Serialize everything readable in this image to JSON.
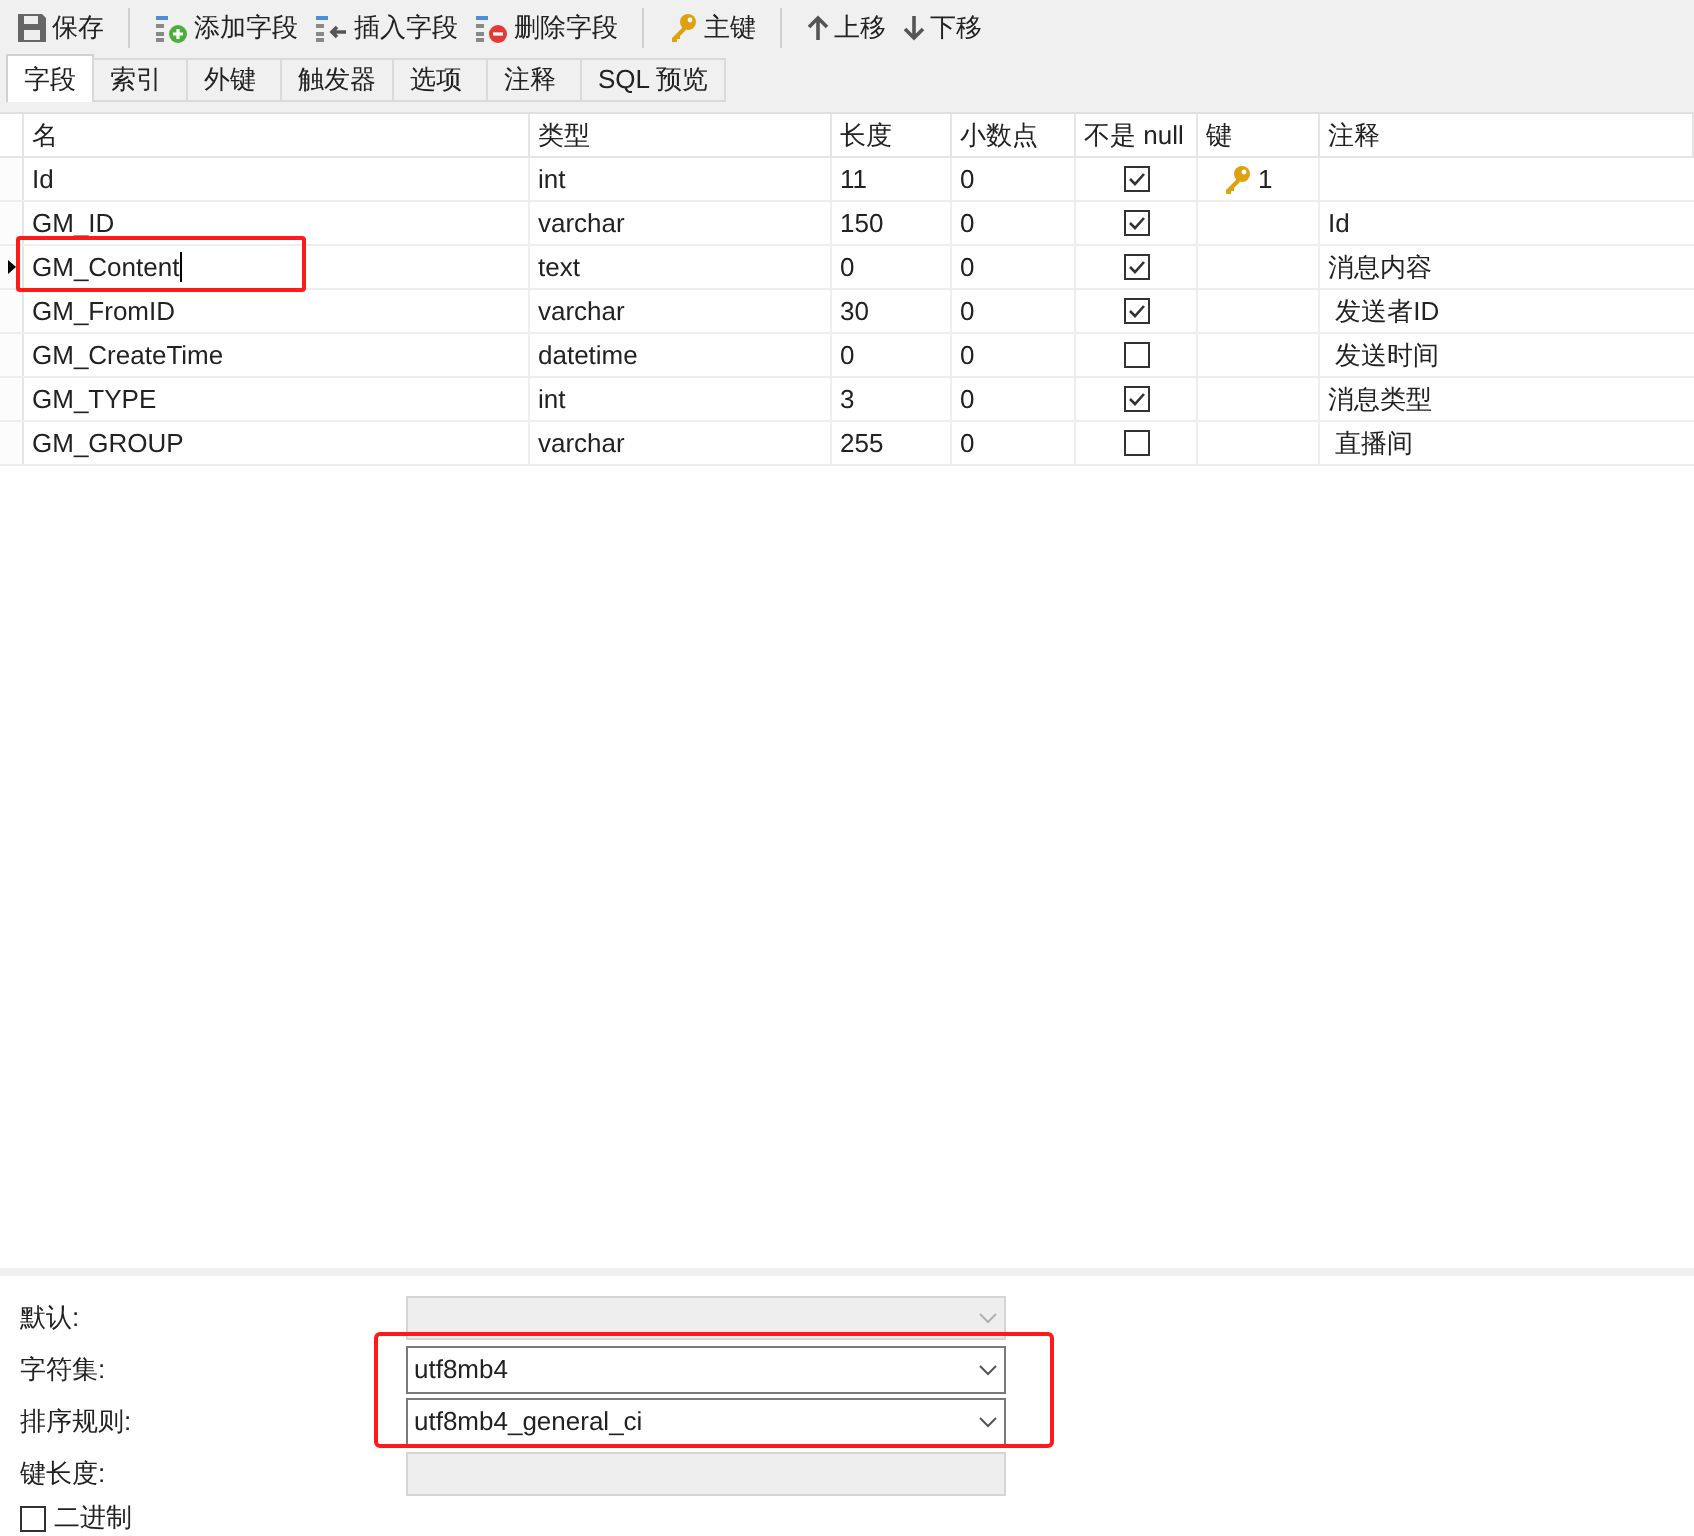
{
  "toolbar": [
    {
      "kind": "save",
      "label": "保存"
    },
    {
      "kind": "add",
      "label": "添加字段"
    },
    {
      "kind": "insert",
      "label": "插入字段"
    },
    {
      "kind": "delete",
      "label": "删除字段"
    },
    {
      "kind": "key",
      "label": "主键"
    },
    {
      "kind": "up",
      "label": "上移"
    },
    {
      "kind": "down",
      "label": "下移"
    }
  ],
  "tabs": [
    {
      "label": "字段",
      "selected": true
    },
    {
      "label": "索引",
      "selected": false
    },
    {
      "label": "外键",
      "selected": false
    },
    {
      "label": "触发器",
      "selected": false
    },
    {
      "label": "选项",
      "selected": false
    },
    {
      "label": "注释",
      "selected": false
    },
    {
      "label": "SQL 预览",
      "selected": false
    }
  ],
  "table": {
    "columns": [
      "名",
      "类型",
      "长度",
      "小数点",
      "不是 null",
      "键",
      "注释"
    ],
    "rows": [
      {
        "name": "Id",
        "type": "int",
        "length": "11",
        "decimals": "0",
        "not_null": true,
        "key": "1",
        "selected": false
      },
      {
        "name": "GM_ID",
        "type": "varchar",
        "length": "150",
        "decimals": "0",
        "not_null": true,
        "comment": "Id",
        "selected": false
      },
      {
        "name": "GM_Content",
        "type": "text",
        "length": "0",
        "decimals": "0",
        "not_null": true,
        "comment": "消息内容",
        "selected": true
      },
      {
        "name": "GM_FromID",
        "type": "varchar",
        "length": "30",
        "decimals": "0",
        "not_null": true,
        "comment": " 发送者ID",
        "selected": false
      },
      {
        "name": "GM_CreateTime",
        "type": "datetime",
        "length": "0",
        "decimals": "0",
        "not_null": false,
        "comment": " 发送时间",
        "selected": false
      },
      {
        "name": "GM_TYPE",
        "type": "int",
        "length": "3",
        "decimals": "0",
        "not_null": true,
        "comment": "消息类型",
        "selected": false
      },
      {
        "name": "GM_GROUP",
        "type": "varchar",
        "length": "255",
        "decimals": "0",
        "not_null": false,
        "comment": " 直播间",
        "selected": false
      }
    ]
  },
  "properties": [
    {
      "kind": "select",
      "label": "默认:",
      "disabled": true
    },
    {
      "kind": "select",
      "label": "字符集:",
      "value": "utf8mb4",
      "disabled": false
    },
    {
      "kind": "select",
      "label": "排序规则:",
      "value": "utf8mb4_general_ci",
      "disabled": false
    },
    {
      "kind": "text",
      "label": "键长度:",
      "disabled": true
    },
    {
      "kind": "checkbox",
      "label": "二进制",
      "checked": false
    }
  ]
}
